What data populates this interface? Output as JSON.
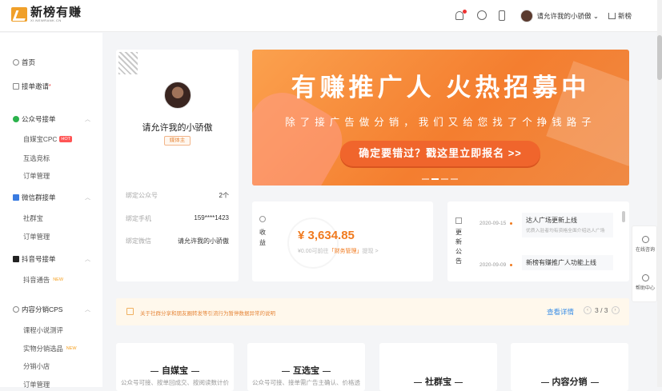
{
  "header": {
    "logo_title": "新榜有赚",
    "logo_sub": "XI.NEWRANK.CN",
    "user_name": "请允许我的小骄傲",
    "home_label": "新榜"
  },
  "sidebar": {
    "home": "首页",
    "invite": "接单邀请",
    "groups": [
      {
        "title": "公众号接单",
        "items": [
          "自媒宝CPC",
          "互选竞标",
          "订单管理"
        ],
        "hot": "HOT"
      },
      {
        "title": "微信群接单",
        "items": [
          "社群宝",
          "订单管理"
        ]
      },
      {
        "title": "抖音号接单",
        "items": [
          "抖音通告"
        ],
        "new": "NEW"
      },
      {
        "title": "内容分销CPS",
        "items": [
          "课程小说测评",
          "实物分销选品",
          "分销小店",
          "订单管理"
        ],
        "new": "NEW"
      }
    ]
  },
  "profile": {
    "name": "请允许我的小骄傲",
    "badge": "媒体主",
    "rows": [
      {
        "label": "绑定公众号",
        "value": "2个"
      },
      {
        "label": "绑定手机",
        "value": "159****1423"
      },
      {
        "label": "绑定微信",
        "value": "请允许我的小骄傲"
      }
    ]
  },
  "banner": {
    "title": "有赚推广人  火热招募中",
    "subtitle": "除了接广告做分销，我们又给您找了个挣钱路子",
    "button": "确定要错过？戳这里立即报名 >>"
  },
  "income": {
    "label": "收益",
    "amount": "¥ 3,634.85",
    "note_prefix": "¥0.00可前往",
    "note_link": "「财务管理」",
    "note_suffix": "提现 >"
  },
  "notice": {
    "label": "更新公告",
    "items": [
      {
        "date": "2020-09-15",
        "title": "达人广场更新上线",
        "desc": "优质入驻者均有资格全面介绍达人广场"
      },
      {
        "date": "2020-09-09",
        "title": "新榜有赚推广人功能上线",
        "desc": ""
      }
    ]
  },
  "alert": {
    "text": "关于社群分享和朋友圈转发等引流行为暂停数据异常的说明",
    "more": "查看详情",
    "page": "3 / 3"
  },
  "products": [
    {
      "title": "自媒宝",
      "desc": "公众号可接、按单回成交、按阅读数计价"
    },
    {
      "title": "互选宝",
      "desc": "公众号可接、接单需广告主确认、价格透"
    },
    {
      "title": "社群宝",
      "desc": ""
    },
    {
      "title": "内容分销",
      "desc": ""
    }
  ],
  "float": {
    "service": "在线咨询",
    "help": "帮助中心"
  },
  "colors": {
    "accent": "#f07a1f",
    "banner": "#f47e2f",
    "link": "#3a8ee6"
  }
}
